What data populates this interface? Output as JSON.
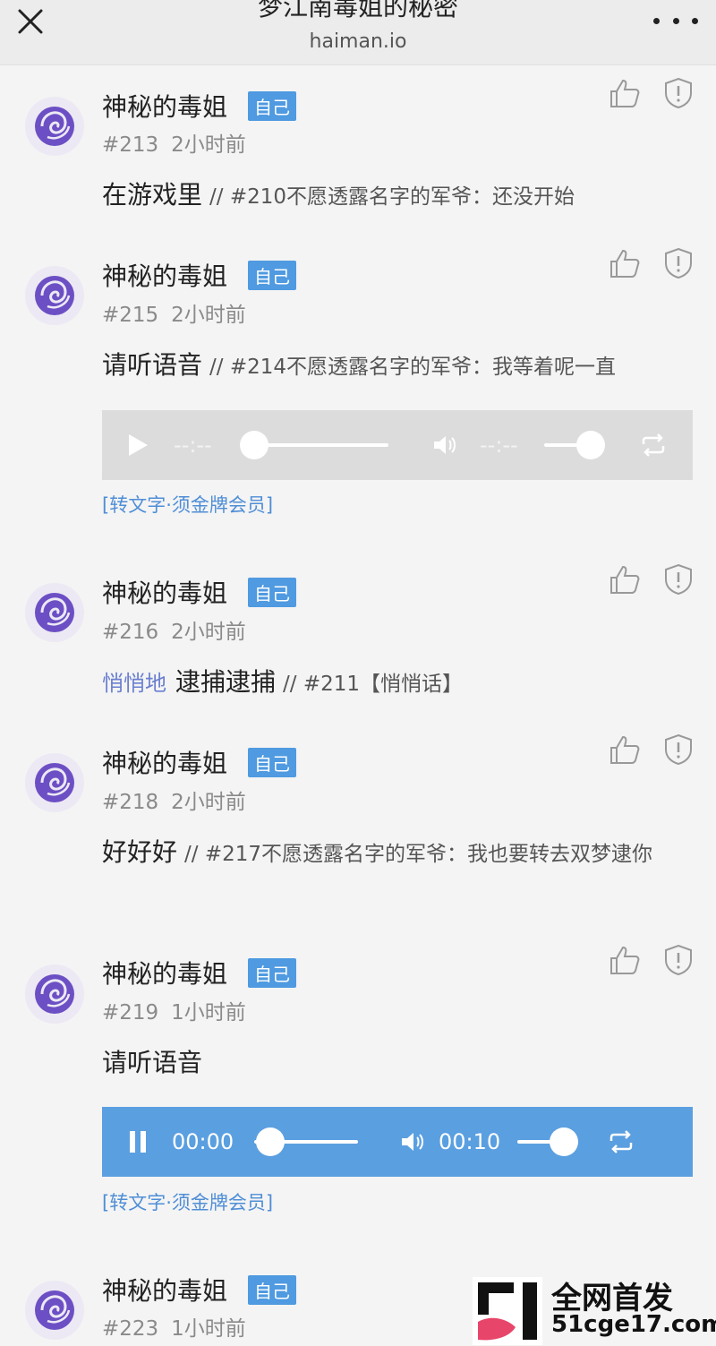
{
  "header": {
    "title": "梦江南毒姐的秘密",
    "domain": "haiman.io"
  },
  "author": {
    "name": "神秘的毒姐",
    "badge": "自己"
  },
  "posts": [
    {
      "id": "#213",
      "time": "2小时前",
      "text": "在游戏里",
      "quote": "// #210不愿透露名字的军爷：还没开始"
    },
    {
      "id": "#215",
      "time": "2小时前",
      "text": "请听语音",
      "quote": "// #214不愿透露名字的军爷：我等着呢一直",
      "audio": {
        "state": "paused",
        "current": "--:--",
        "duration": "--:--",
        "progress": 0,
        "volume": 1.0
      },
      "transcribe": "[转文字·须金牌会员]"
    },
    {
      "id": "#216",
      "time": "2小时前",
      "whisper": "悄悄地",
      "text": "逮捕逮捕",
      "quote": "// #211【悄悄话】"
    },
    {
      "id": "#218",
      "time": "2小时前",
      "text": "好好好",
      "quote": "// #217不愿透露名字的军爷：我也要转去双梦逮你"
    },
    {
      "id": "#219",
      "time": "1小时前",
      "text": "请听语音",
      "audio": {
        "state": "playing",
        "current": "00:00",
        "duration": "00:10",
        "progress": 0,
        "volume": 1.0
      },
      "transcribe": "[转文字·须金牌会员]"
    },
    {
      "id": "#223",
      "time": "1小时前"
    }
  ],
  "watermark": {
    "title": "全网首发",
    "site": "51cge17.com"
  },
  "colors": {
    "badge": "#4f9ae0",
    "player_active": "#5a9fe0",
    "player_inactive": "#dcdcdc",
    "link": "#4f8ed6",
    "whisper": "#6a7fd0",
    "avatar_rose": "#6c4fc4"
  },
  "icons": [
    "close-icon",
    "more-icon",
    "thumbs-up-icon",
    "shield-alert-icon",
    "play-icon",
    "pause-icon",
    "volume-icon",
    "loop-icon",
    "rose-avatar"
  ]
}
